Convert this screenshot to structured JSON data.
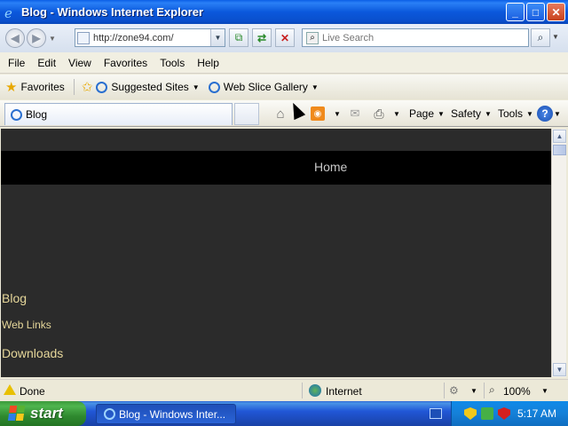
{
  "window": {
    "title": "Blog - Windows Internet Explorer"
  },
  "address": {
    "url": "http://zone94.com/"
  },
  "search": {
    "placeholder": "Live Search"
  },
  "menu": [
    "File",
    "Edit",
    "View",
    "Favorites",
    "Tools",
    "Help"
  ],
  "favorites_bar": {
    "favorites_label": "Favorites",
    "items": [
      {
        "label": "Suggested Sites"
      },
      {
        "label": "Web Slice Gallery"
      }
    ]
  },
  "tab": {
    "label": "Blog"
  },
  "command_bar": {
    "page": "Page",
    "safety": "Safety",
    "tools": "Tools"
  },
  "content": {
    "nav": {
      "home": "Home"
    },
    "sidebar": [
      "Blog",
      "Web Links",
      "Downloads"
    ]
  },
  "status": {
    "text": "Done",
    "zone": "Internet",
    "zoom": "100%"
  },
  "taskbar": {
    "start": "start",
    "task": "Blog - Windows Inter...",
    "clock": "5:17 AM"
  },
  "colors": {
    "titlebar": "#0b58dc",
    "content_bg": "#2b2b2b",
    "link": "#e6d79a",
    "nav_bg": "#000000"
  }
}
